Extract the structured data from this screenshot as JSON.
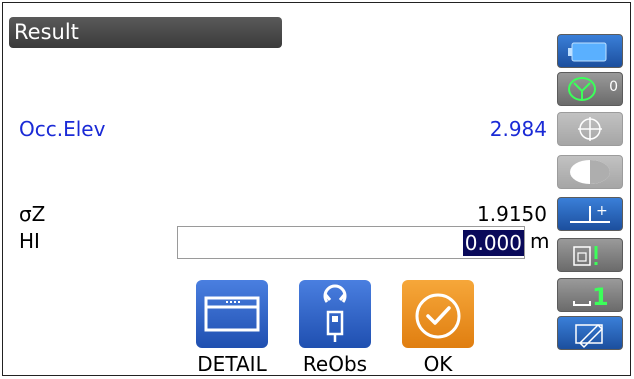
{
  "title": "Result",
  "occ_elev": {
    "label": "Occ.Elev",
    "value": "2.984"
  },
  "sigma_z": {
    "label": "σZ",
    "value": "1.9150"
  },
  "hi": {
    "label": "HI",
    "value": "0.000",
    "unit": "m"
  },
  "softkeys": [
    {
      "label": "DETAIL",
      "icon": "detail-window-icon"
    },
    {
      "label": "ReObs",
      "icon": "reobserve-prism-icon"
    },
    {
      "label": "OK",
      "icon": "check-circle-icon"
    }
  ],
  "side_panel": {
    "battery_icon": "battery-icon",
    "target_count": "0",
    "icons": [
      "battery-icon",
      "prism-target-icon",
      "crosshair-icon",
      "half-circle-icon",
      "height-plus-icon",
      "measure-mode-icon",
      "level-one-icon",
      "edit-pen-icon"
    ]
  },
  "colors": {
    "accent_blue": "#1a2ad6",
    "button_blue": "#2f63c9",
    "button_orange": "#f0921e",
    "title_bar": "#444444"
  }
}
